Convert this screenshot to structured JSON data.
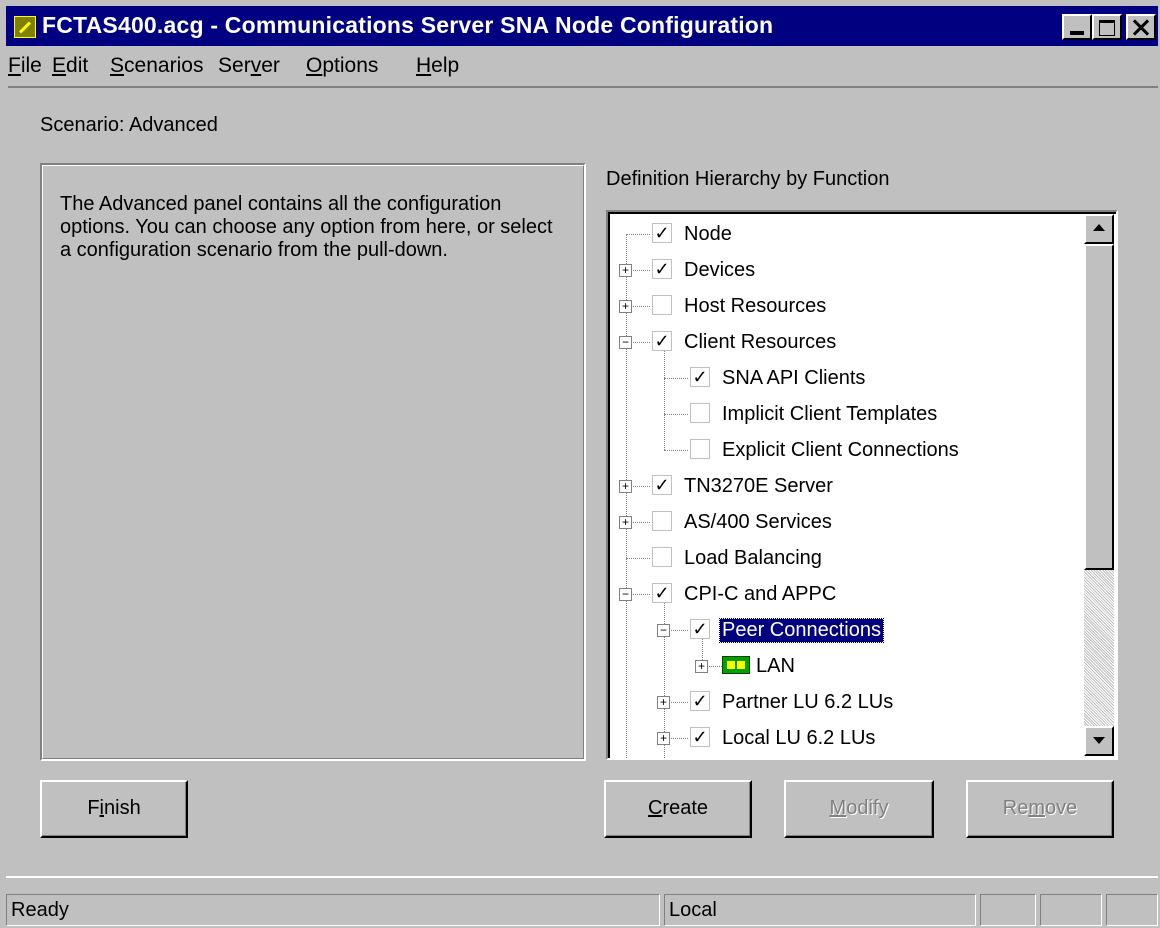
{
  "window": {
    "title": "FCTAS400.acg - Communications Server SNA Node Configuration"
  },
  "menu": [
    "File",
    "Edit",
    "Scenarios",
    "Server",
    "Options",
    "Help"
  ],
  "scenario_label": "Scenario: Advanced",
  "description": "The Advanced panel contains all the configuration options. You can choose any option from here, or select a configuration scenario from the pull-down.",
  "hierarchy_label": "Definition Hierarchy by Function",
  "tree": [
    {
      "label": "Node",
      "checked": true
    },
    {
      "label": "Devices",
      "checked": true,
      "expander": "+"
    },
    {
      "label": "Host Resources",
      "checked": false,
      "expander": "+"
    },
    {
      "label": "Client Resources",
      "checked": true,
      "expander": "-"
    },
    {
      "label": "SNA API Clients",
      "checked": true
    },
    {
      "label": "Implicit Client Templates",
      "checked": false
    },
    {
      "label": "Explicit Client Connections",
      "checked": false
    },
    {
      "label": "TN3270E Server",
      "checked": true,
      "expander": "+"
    },
    {
      "label": "AS/400 Services",
      "checked": false,
      "expander": "+"
    },
    {
      "label": "Load Balancing",
      "checked": false
    },
    {
      "label": "CPI-C and APPC",
      "checked": true,
      "expander": "-"
    },
    {
      "label": "Peer Connections",
      "checked": true,
      "expander": "-",
      "selected": true
    },
    {
      "label": "LAN",
      "icon": "lan-adapter-icon",
      "expander": "+"
    },
    {
      "label": "Partner LU 6.2 LUs",
      "checked": true,
      "expander": "+"
    },
    {
      "label": "Local LU 6.2 LUs",
      "checked": true,
      "expander": "+"
    }
  ],
  "buttons": {
    "finish": "Finish",
    "create": "Create",
    "modify": "Modify",
    "remove": "Remove"
  },
  "status": {
    "ready": "Ready",
    "location": "Local"
  }
}
